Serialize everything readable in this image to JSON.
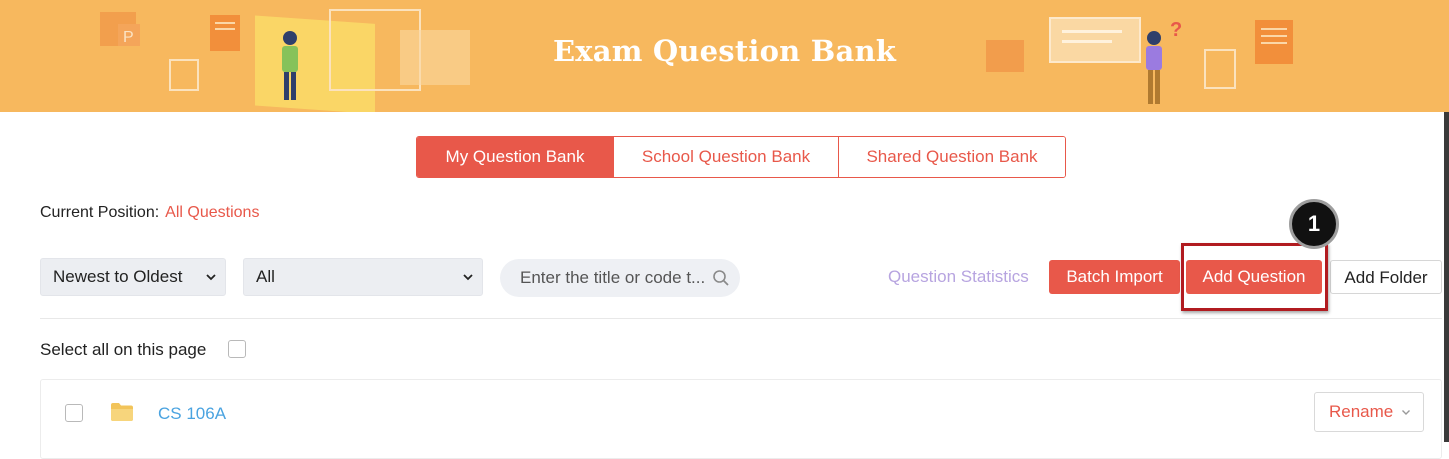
{
  "banner": {
    "title": "Exam Question Bank"
  },
  "tabs": [
    {
      "label": "My Question Bank",
      "active": true
    },
    {
      "label": "School Question Bank",
      "active": false
    },
    {
      "label": "Shared Question Bank",
      "active": false
    }
  ],
  "position": {
    "label": "Current Position:",
    "value": "All Questions"
  },
  "filters": {
    "sort": {
      "selected": "Newest to Oldest"
    },
    "category": {
      "selected": "All"
    },
    "search": {
      "placeholder": "Enter the title or code t..."
    }
  },
  "toolbar": {
    "stats_label": "Question Statistics",
    "batch_import_label": "Batch Import",
    "add_question_label": "Add Question",
    "add_folder_label": "Add Folder"
  },
  "annotation": {
    "step": "1"
  },
  "list": {
    "select_all_label": "Select all on this page",
    "items": [
      {
        "name": "CS 106A",
        "action_label": "Rename",
        "icon": "folder-icon"
      }
    ]
  },
  "colors": {
    "accent": "#e8584a",
    "banner": "#f7b85e",
    "link": "#4aa3e0",
    "stats": "#b7a4e0",
    "highlight": "#b11b20"
  }
}
